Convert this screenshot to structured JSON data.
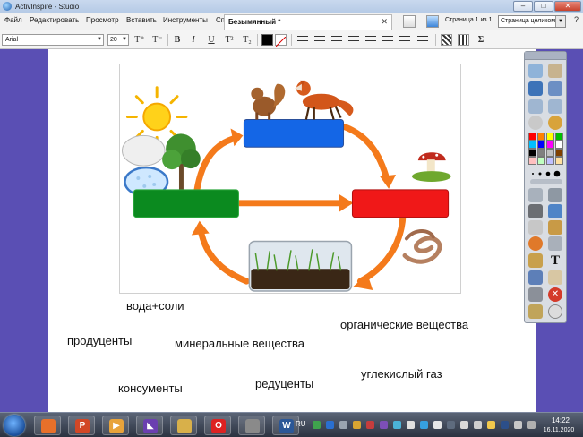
{
  "window": {
    "title": "ActivInspire - Studio",
    "minimize": "–",
    "maximize": "□",
    "close": "✕"
  },
  "menu": {
    "items": [
      "Файл",
      "Редактировать",
      "Просмотр",
      "Вставить",
      "Инструменты",
      "Справка"
    ],
    "document_tab": "Безымянный *",
    "tab_close": "✕",
    "page_indicator": "Страница 1 из 1",
    "view_mode": "Страница целиком",
    "help_icon": "?"
  },
  "format": {
    "font": "Arial",
    "size": "20",
    "buttons": [
      "T⁺",
      "T⁻",
      "B",
      "I",
      "U",
      "T²",
      "T₂"
    ],
    "sigma": "Σ"
  },
  "canvas": {
    "words": [
      "вода+соли",
      "органические вещества",
      "продуценты",
      "минеральные вещества",
      "углекислый газ",
      "редуценты",
      "консументы"
    ]
  },
  "diagram": {
    "colors": {
      "blue": "#1466e6",
      "green": "#0b8a1f",
      "red": "#f01818",
      "arrow": "#f47a1b"
    },
    "icons": [
      "sun-icon",
      "tree-icon",
      "cloud-icon",
      "water-drop-icon",
      "squirrel-icon",
      "fox-icon",
      "mushroom-icon",
      "worm-icon",
      "soil-grass-icon"
    ]
  },
  "toolbox": {
    "palette": [
      "#ff0000",
      "#ff8000",
      "#ffff00",
      "#00c000",
      "#00c0ff",
      "#0000ff",
      "#ff00ff",
      "#ffffff",
      "#000000",
      "#808080",
      "#c0c0c0",
      "#804000",
      "#ffc0c0",
      "#c0ffc0",
      "#c0c0ff",
      "#ffe0a0"
    ],
    "text_tool": "T",
    "delete_tool": "✕"
  },
  "taskbar": {
    "apps": [
      "firefox",
      "powerpoint",
      "media",
      "visual-studio",
      "explorer",
      "opera",
      "inspire",
      "word"
    ],
    "app_glyphs": [
      "",
      "P",
      "▶",
      "◣",
      "",
      "O",
      "",
      "W"
    ],
    "language": "RU",
    "time": "14:22",
    "date": "16.11.2020"
  }
}
